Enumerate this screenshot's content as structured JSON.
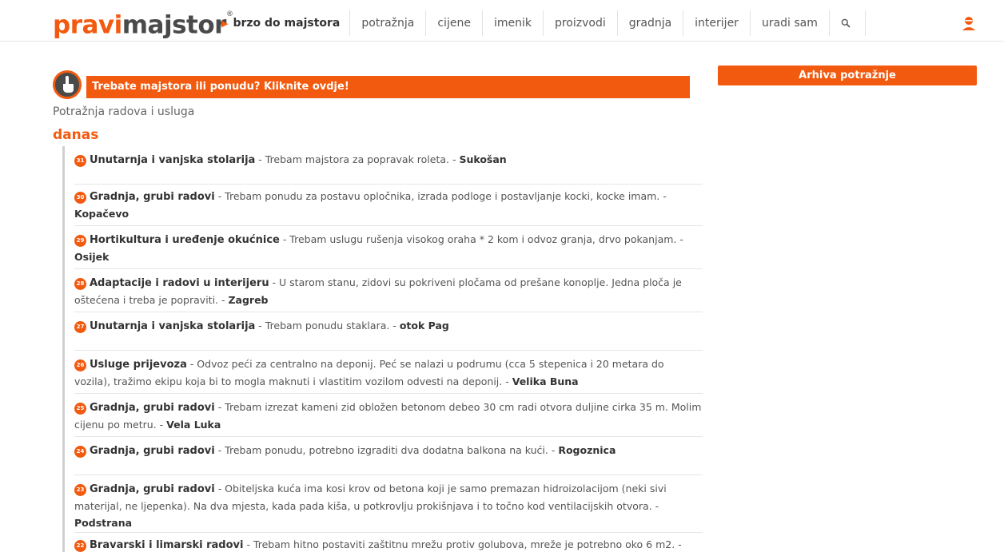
{
  "header": {
    "logo_part1": "pravi",
    "logo_part2": "majstor",
    "logo_mark": "®",
    "quick_link": "brzo do majstora",
    "nav": [
      "potražnja",
      "cijene",
      "imenik",
      "proizvodi",
      "gradnja",
      "interijer",
      "uradi sam"
    ],
    "search_icon": "search-icon",
    "user_icon": "user-icon"
  },
  "colors": {
    "accent": "#f25a0f",
    "dark": "#4a4a4a"
  },
  "cta": {
    "label": "Trebate majstora ili ponudu? Kliknite ovdje!",
    "icon": "hand-pointer-icon"
  },
  "archive_button": "Arhiva potražnje",
  "section": {
    "subtitle": "Potražnja radova i usluga",
    "day": "danas"
  },
  "requests": [
    {
      "num": "31",
      "category": "Unutarnja i vanjska stolarija",
      "text": " - Trebam majstora za popravak roleta. - ",
      "location": "Sukošan"
    },
    {
      "num": "30",
      "category": "Gradnja, grubi radovi",
      "text": " - Trebam ponudu za postavu opločnika, izrada podloge i postavljanje kocki, kocke imam. - ",
      "location": "Kopačevo"
    },
    {
      "num": "29",
      "category": "Hortikultura i uređenje okućnice",
      "text": " - Trebam uslugu rušenja visokog oraha * 2 kom i odvoz granja, drvo pokanjam. - ",
      "location": "Osijek"
    },
    {
      "num": "28",
      "category": "Adaptacije i radovi u interijeru",
      "text": " - U starom stanu, zidovi su pokriveni pločama od prešane konoplje. Jedna ploča je oštećena i treba je popraviti. - ",
      "location": "Zagreb"
    },
    {
      "num": "27",
      "category": "Unutarnja i vanjska stolarija",
      "text": " - Trebam ponudu staklara. - ",
      "location": "otok Pag"
    },
    {
      "num": "26",
      "category": "Usluge prijevoza",
      "text": " - Odvoz peći za centralno na deponij. Peć se nalazi u podrumu (cca 5 stepenica i 20 metara do vozila), tražimo ekipu koja bi to mogla maknuti i vlastitim vozilom odvesti na deponij. - ",
      "location": "Velika Buna"
    },
    {
      "num": "25",
      "category": "Gradnja, grubi radovi",
      "text": " - Trebam izrezat kameni zid obložen betonom debeo 30 cm radi otvora duljine cirka 35 m. Molim cijenu po metru. - ",
      "location": "Vela Luka"
    },
    {
      "num": "24",
      "category": "Gradnja, grubi radovi",
      "text": " - Trebam ponudu, potrebno izgraditi dva dodatna balkona na kući. - ",
      "location": "Rogoznica"
    },
    {
      "num": "23",
      "category": "Gradnja, grubi radovi",
      "text": " - Obiteljska kuća ima kosi krov od betona koji je samo premazan hidroizolacijom (neki sivi materijal, ne ljepenka). Na dva mjesta, kada pada kiša, u potkrovlju prokišnjava i to točno kod ventilacijskih otvora. - ",
      "location": "Podstrana"
    },
    {
      "num": "22",
      "category": "Bravarski i limarski radovi",
      "text": " - Trebam hitno postaviti zaštitnu mrežu protiv golubova, mreže je potrebno oko 6 m2. - ",
      "location": ""
    }
  ]
}
